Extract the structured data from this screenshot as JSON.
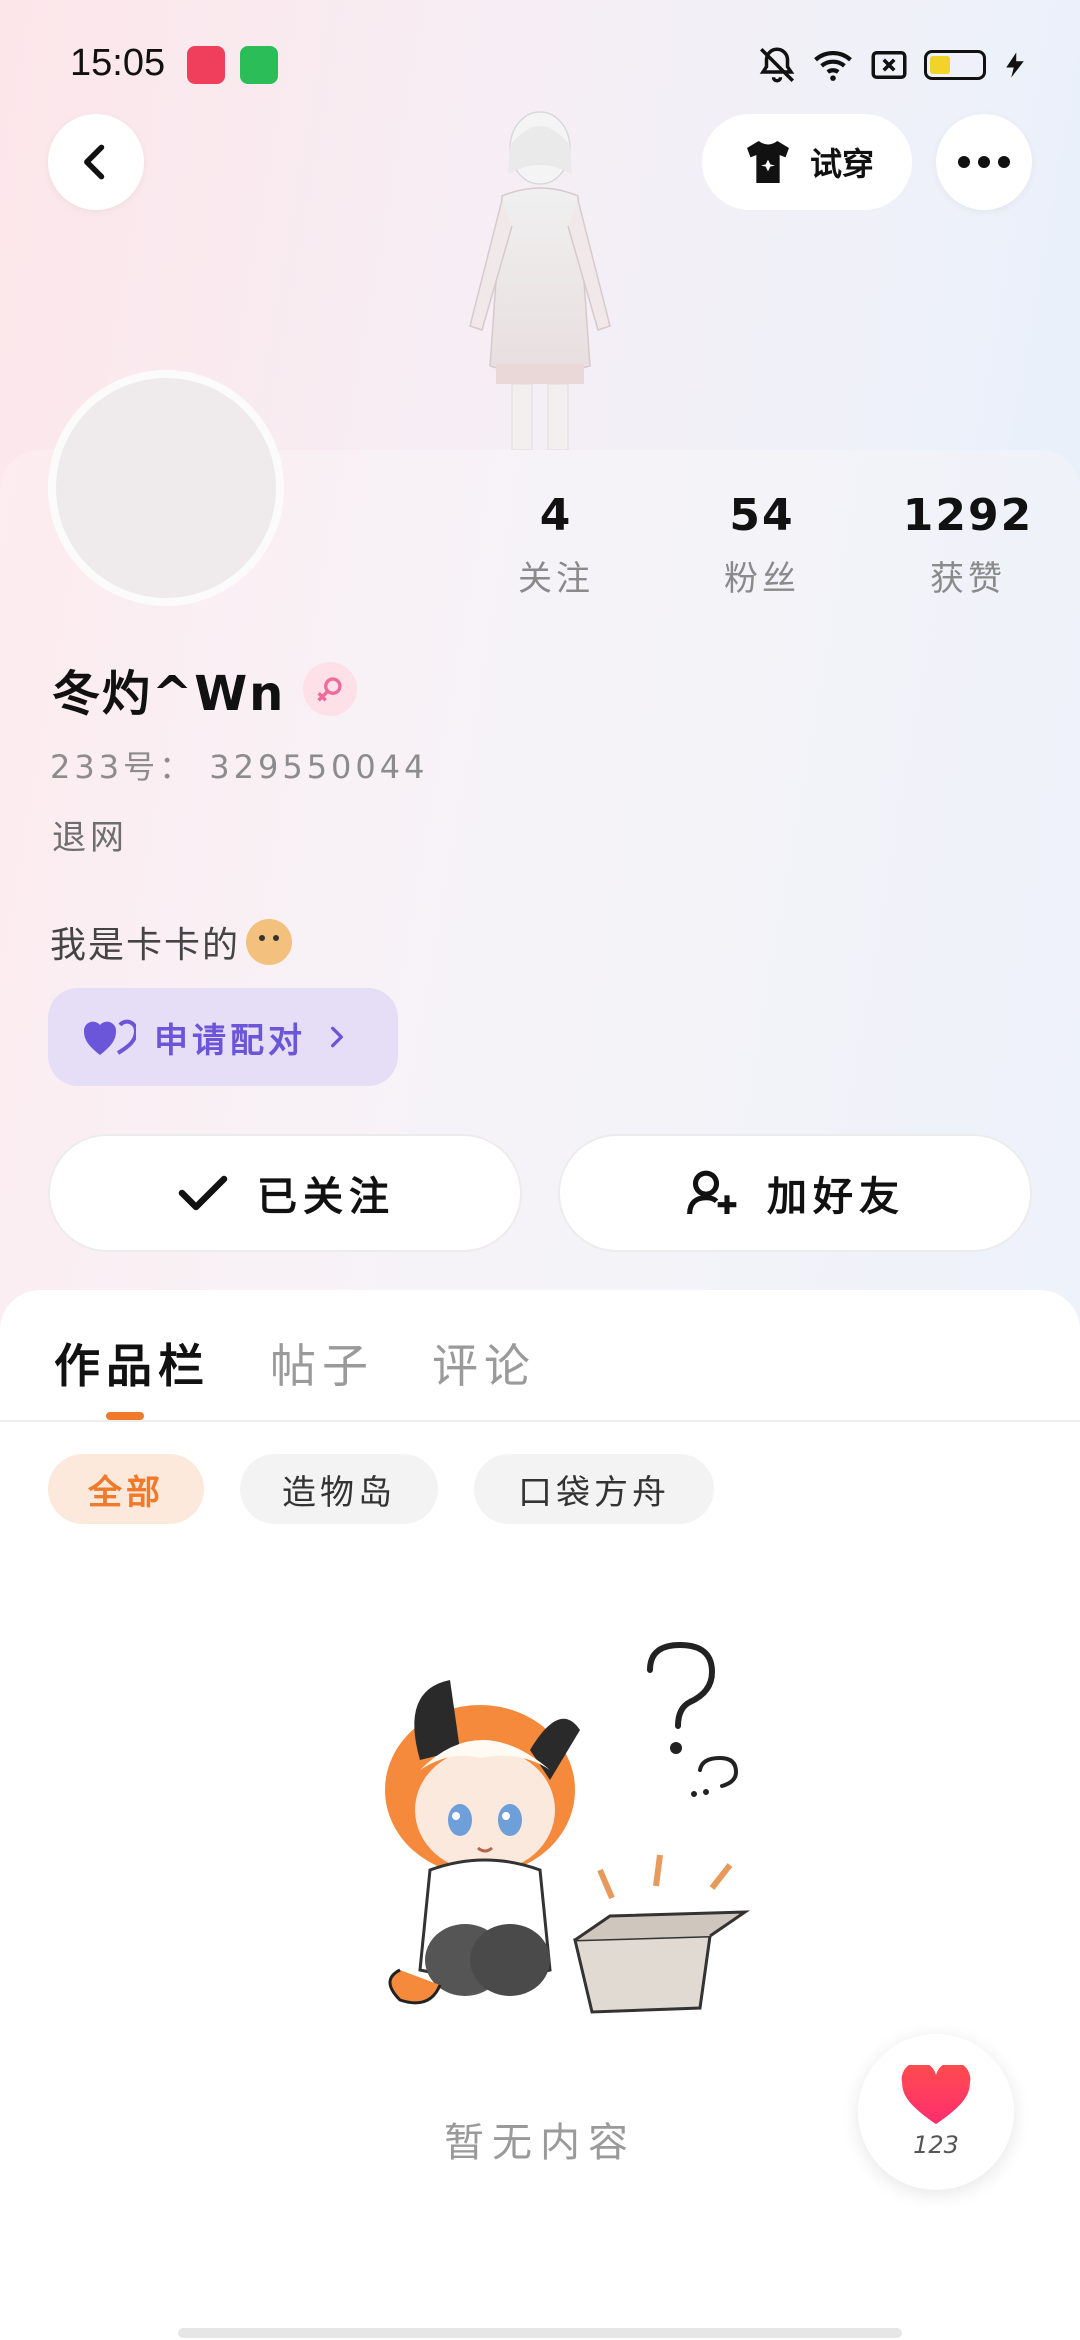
{
  "status_bar": {
    "time": "15:05",
    "icons": [
      "app-badge-video-icon",
      "app-badge-store-icon",
      "bell-muted-icon",
      "wifi-icon",
      "sim-off-icon",
      "battery-icon",
      "charging-icon"
    ],
    "battery_color": "#f1d32a"
  },
  "header": {
    "back_icon": "chevron-left-icon",
    "tryon_label": "试穿",
    "tryon_icon": "shirt-icon",
    "more_icon": "more-dots-icon"
  },
  "profile": {
    "stats": [
      {
        "value": "4",
        "label": "关注"
      },
      {
        "value": "54",
        "label": "粉丝"
      },
      {
        "value": "1292",
        "label": "获赞"
      }
    ],
    "username": "冬灼^Wn",
    "gender_icon": "female-icon",
    "uid_line": "233号： 329550044",
    "status_line": "退网",
    "bio": "我是卡卡的",
    "bio_icon": "doge-emoji-icon",
    "pair_button": {
      "label": "申请配对",
      "icon": "heart-icon",
      "arrow_icon": "chevron-right-icon",
      "color": "#6b55d8"
    },
    "follow_button": {
      "label": "已关注",
      "icon": "check-icon"
    },
    "friend_button": {
      "label": "加好友",
      "icon": "add-user-icon"
    }
  },
  "content": {
    "tabs": [
      {
        "label": "作品栏",
        "active": true
      },
      {
        "label": "帖子",
        "active": false
      },
      {
        "label": "评论",
        "active": false
      }
    ],
    "accent_color": "#f07a2a",
    "chips": [
      {
        "label": "全部",
        "active": true
      },
      {
        "label": "造物岛",
        "active": false
      },
      {
        "label": "口袋方舟",
        "active": false
      }
    ],
    "empty_text": "暂无内容"
  },
  "like_fab": {
    "count": "123",
    "icon": "heart-icon"
  }
}
